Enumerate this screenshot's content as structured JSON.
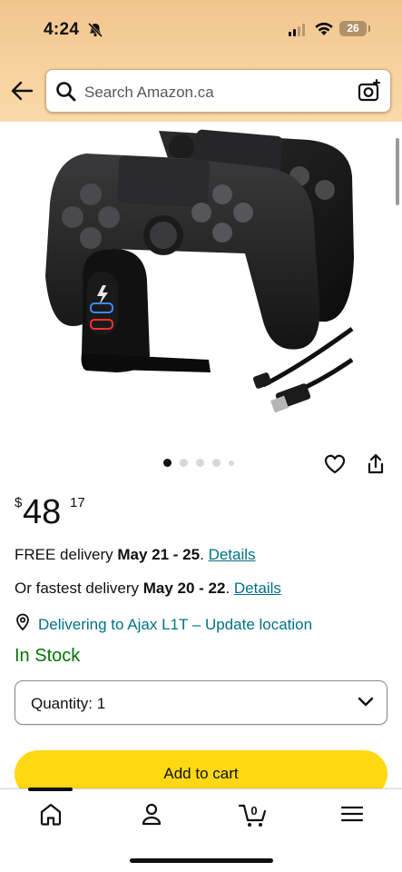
{
  "status_bar": {
    "time": "4:24",
    "battery": "26"
  },
  "search": {
    "placeholder": "Search Amazon.ca"
  },
  "product": {
    "image_alt": "Dual PS4 controller charging station with two black controllers and USB cable",
    "carousel": {
      "count": 5,
      "active": 0
    },
    "price": {
      "currency": "$",
      "whole": "48",
      "fraction": "17"
    },
    "delivery": {
      "free_prefix": "FREE delivery ",
      "free_dates": "May 21 - 25",
      "free_suffix": ". ",
      "free_link": "Details",
      "fast_prefix": "Or fastest delivery ",
      "fast_dates": "May 20 - 22",
      "fast_suffix": ". ",
      "fast_link": "Details"
    },
    "location": "Delivering to Ajax L1T – Update location",
    "stock": "In Stock",
    "quantity": {
      "label": "Quantity:",
      "value": "1"
    },
    "add_to_cart": "Add to cart"
  },
  "tabbar": {
    "items": [
      "home",
      "account",
      "cart",
      "menu"
    ],
    "cart_count": "0",
    "active": "home"
  },
  "colors": {
    "header_bg": "#f7d29e",
    "link": "#007185",
    "in_stock": "#007600",
    "add_to_cart_bg": "#ffd814"
  }
}
